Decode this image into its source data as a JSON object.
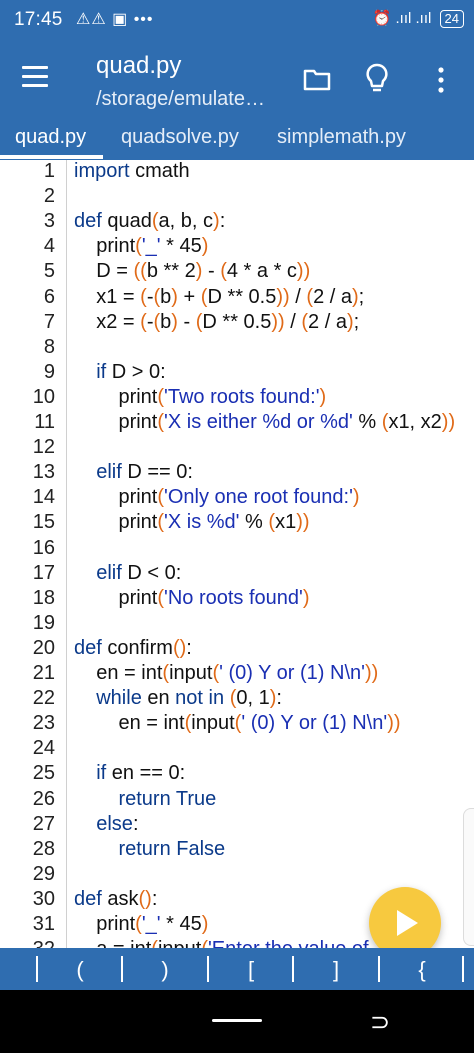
{
  "status": {
    "time": "17:45",
    "left_icons": "⚠⚠ ▣ •••",
    "right_icons": "⏰ .ııl .ııl",
    "battery": "24"
  },
  "appbar": {
    "file_name": "quad.py",
    "path": "/storage/emulate…",
    "icons": [
      "menu-icon",
      "folder-icon",
      "lightbulb-icon",
      "more-vert-icon"
    ]
  },
  "tabs": [
    {
      "label": "quad.py"
    },
    {
      "label": "quadsolve.py"
    },
    {
      "label": "simplemath.py"
    }
  ],
  "editor": {
    "line_numbers": [
      "1",
      "2",
      "3",
      "4",
      "5",
      "6",
      "7",
      "8",
      "9",
      "10",
      "11",
      "12",
      "13",
      "14",
      "15",
      "16",
      "17",
      "18",
      "19",
      "20",
      "21",
      "22",
      "23",
      "24",
      "25",
      "26",
      "27",
      "28",
      "29",
      "30",
      "31",
      "32"
    ],
    "lines": [
      "import cmath",
      "",
      "def quad(a, b, c):",
      "    print('_' * 45)",
      "    D = ((b ** 2) - (4 * a * c))",
      "    x1 = (-(b) + (D ** 0.5)) / (2 / a);",
      "    x2 = (-(b) - (D ** 0.5)) / (2 / a);",
      "",
      "    if D > 0:",
      "        print('Two roots found:')",
      "        print('X is either %d or %d' % (x1, x2))",
      "",
      "    elif D == 0:",
      "        print('Only one root found:')",
      "        print('X is %d' % (x1))",
      "",
      "    elif D < 0:",
      "        print('No roots found')",
      "",
      "def confirm():",
      "    en = int(input(' (0) Y or (1) N\\n'))",
      "    while en not in (0, 1):",
      "        en = int(input(' (0) Y or (1) N\\n'))",
      "",
      "    if en == 0:",
      "        return True",
      "    else:",
      "        return False",
      "",
      "def ask():",
      "    print('_' * 45)",
      "    a = int(input('Enter the value of"
    ]
  },
  "symbols": [
    "(",
    ")",
    "[",
    "]",
    "{"
  ],
  "fab": {
    "icon": "play-icon"
  },
  "navbar": {
    "back_icon": "⊃"
  }
}
